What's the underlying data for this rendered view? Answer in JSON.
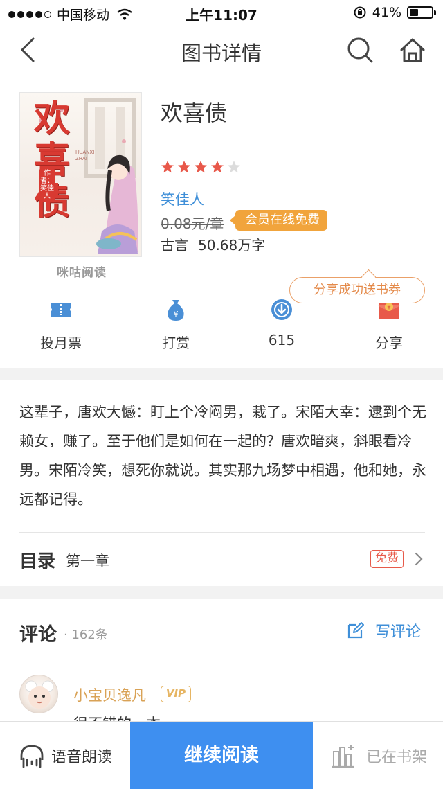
{
  "status_bar": {
    "carrier": "中国移动",
    "time": "上午11:07",
    "battery": "41%",
    "battery_level": 0.41
  },
  "nav": {
    "title": "图书详情"
  },
  "book": {
    "cover": {
      "title_chars": "欢喜债",
      "author_tag": "作者：笑佳人",
      "pinyin": "HUANXI ZHAI",
      "publisher_logo": "咪咕阅读"
    },
    "title": "欢喜债",
    "rating": 4,
    "rating_max": 5,
    "author": "笑佳人",
    "price": "0.08元/章",
    "vip_badge": "会员在线免费",
    "genre": "古言",
    "word_count": "50.68万字"
  },
  "actions": [
    {
      "label": "投月票",
      "icon": "ticket-icon"
    },
    {
      "label": "打赏",
      "icon": "money-bag-icon"
    },
    {
      "label": "615",
      "icon": "download-icon"
    },
    {
      "label": "分享",
      "icon": "red-envelope-icon"
    }
  ],
  "share_tip": "分享成功送书券",
  "description": "这辈子，唐欢大憾：盯上个冷闷男，栽了。宋陌大幸：逮到个无赖女，赚了。至于他们是如何在一起的？唐欢暗爽，斜眼看冷男。宋陌冷笑，想死你就说。其实那九场梦中相遇，他和她，永远都记得。",
  "toc": {
    "label": "目录",
    "chapter": "第一章",
    "tag": "免费"
  },
  "comments": {
    "title": "评论",
    "count": "· 162条",
    "write_label": "写评论",
    "first": {
      "username": "小宝贝逸凡",
      "badge": "VIP",
      "text_peek": "很不错的一本"
    }
  },
  "bottom": {
    "listen": "语音朗读",
    "continue": "继续阅读",
    "shelf": "已在书架"
  },
  "colors": {
    "accent_blue": "#3e8ff0",
    "link_blue": "#3f8fd8",
    "star_red": "#e8584a",
    "vip_orange": "#f1a43c"
  }
}
